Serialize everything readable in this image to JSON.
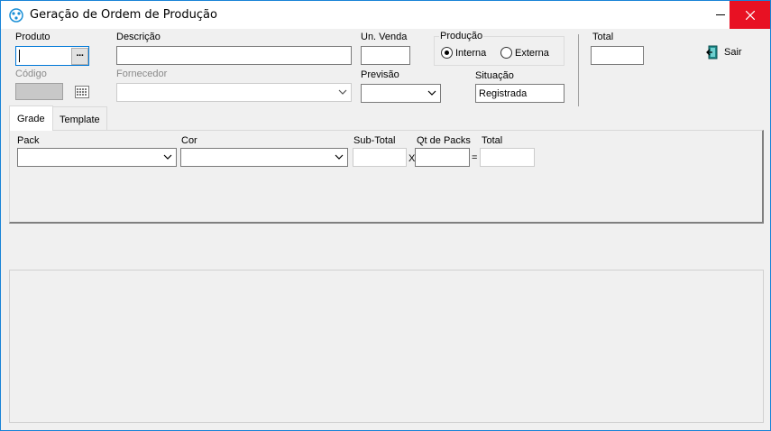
{
  "window": {
    "title": "Geração de Ordem de Produção"
  },
  "form": {
    "produto": {
      "label": "Produto",
      "value": ""
    },
    "descricao": {
      "label": "Descrição",
      "value": ""
    },
    "un_venda": {
      "label": "Un. Venda",
      "value": ""
    },
    "producao": {
      "label": "Produção",
      "options": [
        {
          "label": "Interna",
          "checked": true
        },
        {
          "label": "Externa",
          "checked": false
        }
      ]
    },
    "total": {
      "label": "Total",
      "value": ""
    },
    "codigo": {
      "label": "Código",
      "value": ""
    },
    "fornecedor": {
      "label": "Fornecedor",
      "value": ""
    },
    "previsao": {
      "label": "Previsão",
      "value": ""
    },
    "situacao": {
      "label": "Situação",
      "value": "Registrada"
    }
  },
  "toolbar": {
    "sair_label": "Sair",
    "ellipsis_label": "···"
  },
  "tabs": [
    {
      "label": "Grade",
      "active": true
    },
    {
      "label": "Template",
      "active": false
    }
  ],
  "grade": {
    "pack": {
      "label": "Pack",
      "value": ""
    },
    "cor": {
      "label": "Cor",
      "value": ""
    },
    "sub_total": {
      "label": "Sub-Total",
      "value": ""
    },
    "times_sign": "X",
    "qt_packs": {
      "label": "Qt de Packs",
      "value": ""
    },
    "equals_sign": "=",
    "total": {
      "label": "Total",
      "value": ""
    }
  },
  "colors": {
    "window_border": "#1883d7",
    "close_button": "#e81123",
    "focus_border": "#0078d7",
    "background": "#f0f0f0"
  },
  "icons": [
    "app-icon",
    "minimize-icon",
    "close-icon",
    "ellipsis-icon",
    "calendar-icon",
    "chevron-down-icon",
    "exit-door-icon"
  ]
}
